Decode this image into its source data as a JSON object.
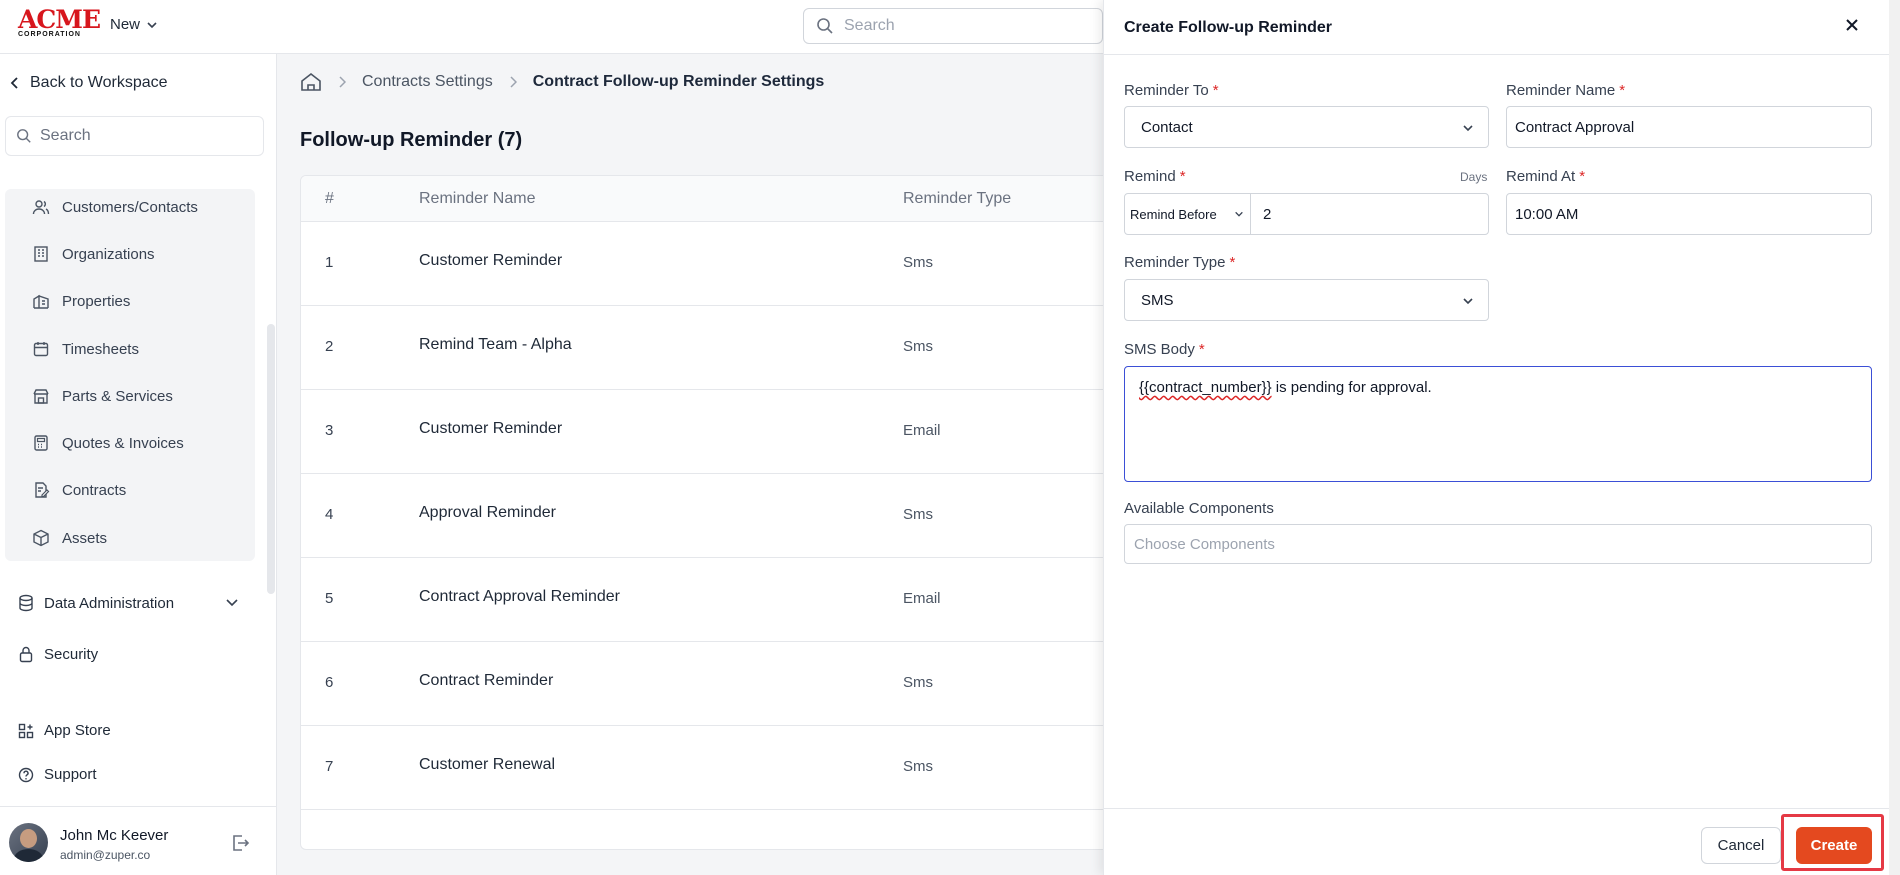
{
  "brand": {
    "logo_text": "ACME",
    "logo_sub": "CORPORATION",
    "color": "#d7161d"
  },
  "topbar": {
    "new_label": "New",
    "search_placeholder": "Search"
  },
  "sidebar": {
    "back_label": "Back to Workspace",
    "search_placeholder": "Search",
    "items": [
      {
        "label": "Customers/Contacts",
        "icon": "users-icon"
      },
      {
        "label": "Organizations",
        "icon": "building-icon"
      },
      {
        "label": "Properties",
        "icon": "property-icon"
      },
      {
        "label": "Timesheets",
        "icon": "calendar-icon"
      },
      {
        "label": "Parts & Services",
        "icon": "store-icon"
      },
      {
        "label": "Quotes & Invoices",
        "icon": "calculator-icon"
      },
      {
        "label": "Contracts",
        "icon": "contract-icon"
      },
      {
        "label": "Assets",
        "icon": "box-icon"
      }
    ],
    "data_admin_label": "Data Administration",
    "security_label": "Security",
    "app_store_label": "App Store",
    "support_label": "Support"
  },
  "user": {
    "name": "John Mc Keever",
    "email": "admin@zuper.co"
  },
  "breadcrumb": {
    "parent": "Contracts Settings",
    "current": "Contract Follow-up Reminder Settings"
  },
  "page": {
    "title": "Follow-up Reminder (7)"
  },
  "table": {
    "headers": {
      "num": "#",
      "name": "Reminder Name",
      "type": "Reminder Type"
    },
    "rows": [
      {
        "num": "1",
        "name": "Customer Reminder",
        "type": "Sms"
      },
      {
        "num": "2",
        "name": "Remind Team - Alpha",
        "type": "Sms"
      },
      {
        "num": "3",
        "name": "Customer Reminder",
        "type": "Email"
      },
      {
        "num": "4",
        "name": "Approval Reminder",
        "type": "Sms"
      },
      {
        "num": "5",
        "name": "Contract Approval Reminder",
        "type": "Email"
      },
      {
        "num": "6",
        "name": "Contract Reminder",
        "type": "Sms"
      },
      {
        "num": "7",
        "name": "Customer Renewal",
        "type": "Sms"
      }
    ]
  },
  "panel": {
    "title": "Create Follow-up Reminder",
    "reminder_to": {
      "label": "Reminder To",
      "value": "Contact"
    },
    "reminder_name": {
      "label": "Reminder Name",
      "value": "Contract Approval"
    },
    "remind": {
      "label": "Remind",
      "units": "Days",
      "mode": "Remind Before",
      "value": "2"
    },
    "remind_at": {
      "label": "Remind At",
      "value": "10:00 AM"
    },
    "reminder_type": {
      "label": "Reminder Type",
      "value": "SMS"
    },
    "sms_body": {
      "label": "SMS Body",
      "token": "{{contract_number}}",
      "text": " is pending for approval."
    },
    "components": {
      "label": "Available Components",
      "placeholder": "Choose Components"
    },
    "cancel_label": "Cancel",
    "create_label": "Create",
    "accent": "#e4491f"
  }
}
